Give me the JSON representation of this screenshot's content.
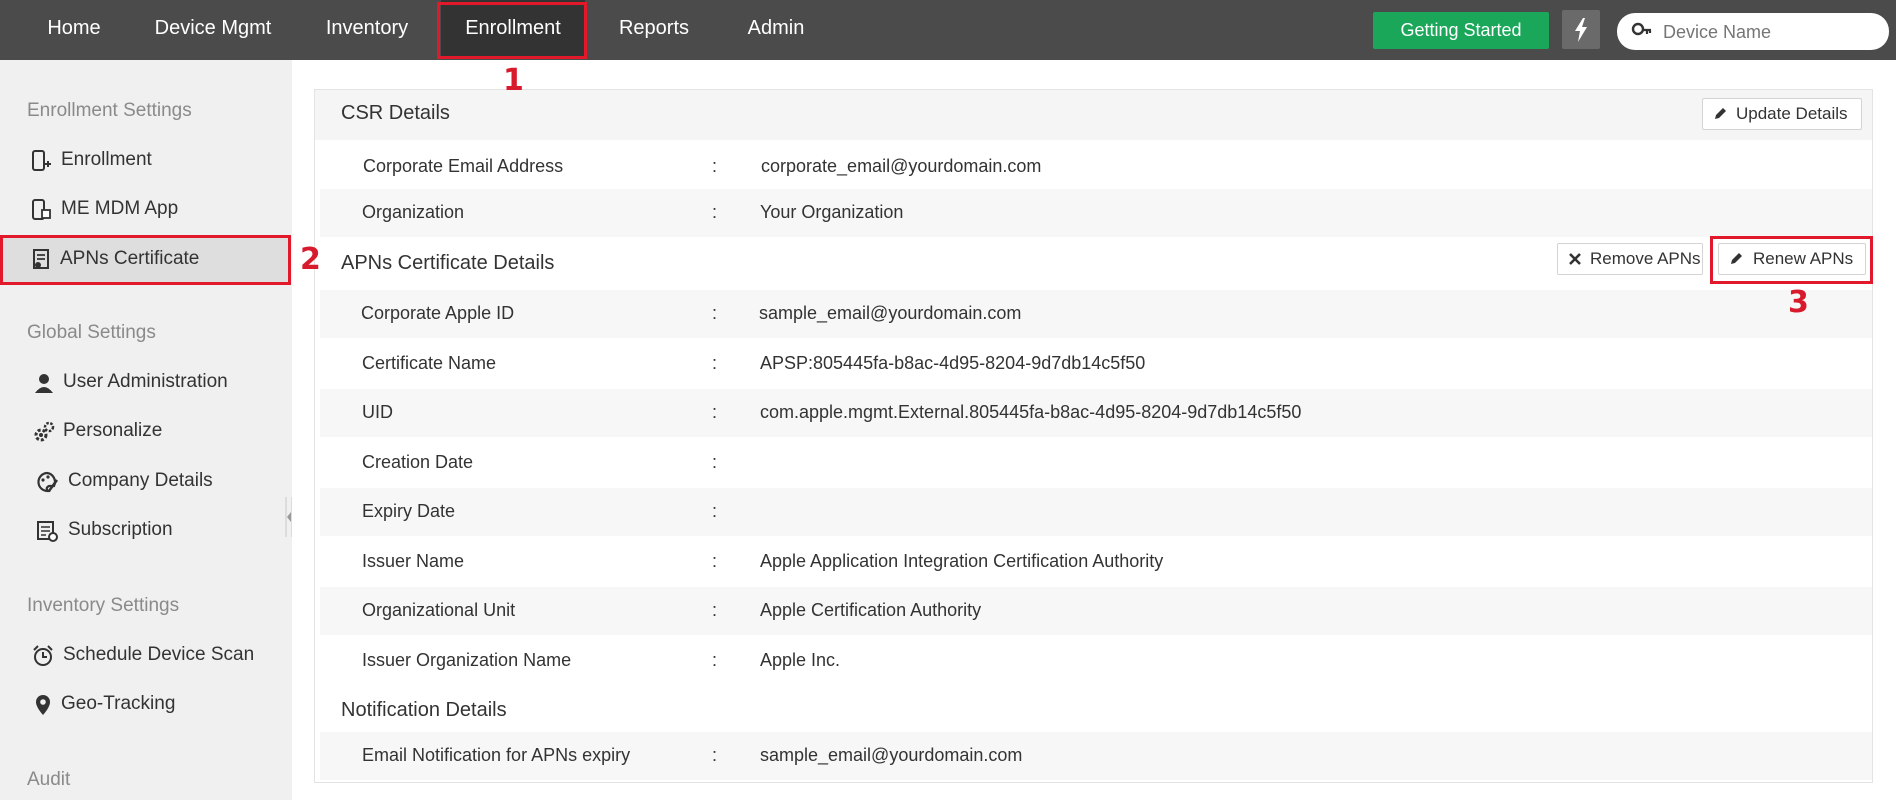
{
  "nav": {
    "items": [
      {
        "label": "Home"
      },
      {
        "label": "Device Mgmt"
      },
      {
        "label": "Inventory"
      },
      {
        "label": "Enrollment"
      },
      {
        "label": "Reports"
      },
      {
        "label": "Admin"
      }
    ],
    "active": "Enrollment",
    "getting_started": "Getting Started",
    "bolt_icon": "lightning-icon",
    "search": {
      "placeholder": "Device Name",
      "icon": "search-key-icon"
    }
  },
  "sidebar": {
    "sections": [
      {
        "heading": "Enrollment Settings",
        "items": [
          {
            "label": "Enrollment",
            "icon": "mobile-add-icon"
          },
          {
            "label": "ME MDM App",
            "icon": "mobile-app-icon"
          },
          {
            "label": "APNs Certificate",
            "icon": "certificate-icon",
            "active": true
          }
        ]
      },
      {
        "heading": "Global Settings",
        "items": [
          {
            "label": "User Administration",
            "icon": "user-icon"
          },
          {
            "label": "Personalize",
            "icon": "gears-icon"
          },
          {
            "label": "Company Details",
            "icon": "palette-icon"
          },
          {
            "label": "Subscription",
            "icon": "subscription-icon"
          }
        ]
      },
      {
        "heading": "Inventory Settings",
        "items": [
          {
            "label": "Schedule Device Scan",
            "icon": "alarm-clock-icon"
          },
          {
            "label": "Geo-Tracking",
            "icon": "map-pin-icon"
          }
        ]
      },
      {
        "heading": "Audit",
        "items": []
      }
    ]
  },
  "csr": {
    "title": "CSR Details",
    "update_button": "Update Details",
    "rows": [
      {
        "label": "Corporate Email Address",
        "value": "corporate_email@yourdomain.com"
      },
      {
        "label": "Organization",
        "value": "Your Organization"
      }
    ]
  },
  "apns": {
    "title": "APNs Certificate Details",
    "remove_button": "Remove APNs",
    "renew_button": "Renew APNs",
    "rows": [
      {
        "label": "Corporate Apple ID",
        "value": "sample_email@yourdomain.com"
      },
      {
        "label": "Certificate Name",
        "value": "APSP:805445fa-b8ac-4d95-8204-9d7db14c5f50"
      },
      {
        "label": "UID",
        "value": "com.apple.mgmt.External.805445fa-b8ac-4d95-8204-9d7db14c5f50"
      },
      {
        "label": "Creation Date",
        "value": ""
      },
      {
        "label": "Expiry Date",
        "value": ""
      },
      {
        "label": "Issuer Name",
        "value": "Apple Application Integration Certification Authority"
      },
      {
        "label": "Organizational Unit",
        "value": "Apple Certification Authority"
      },
      {
        "label": "Issuer Organization Name",
        "value": "Apple Inc."
      }
    ]
  },
  "notification": {
    "title": "Notification Details",
    "rows": [
      {
        "label": "Email Notification for APNs expiry",
        "value": "sample_email@yourdomain.com"
      }
    ]
  },
  "colon": ":",
  "markers": {
    "one": "1",
    "two": "2",
    "three": "3"
  },
  "colors": {
    "topbar": "#4b4b4b",
    "accent_green": "#1aa75a",
    "highlight_red": "#e2182b"
  }
}
